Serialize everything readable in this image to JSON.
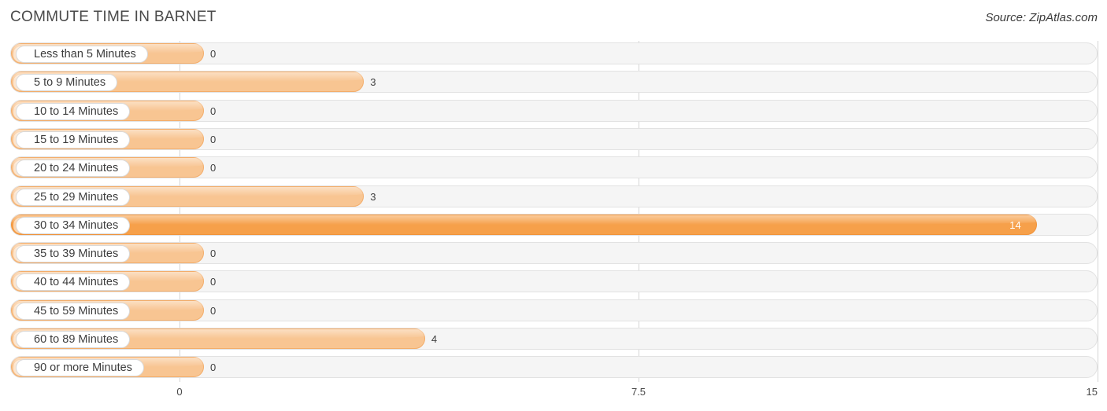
{
  "header": {
    "title": "COMMUTE TIME IN BARNET",
    "source": "Source: ZipAtlas.com"
  },
  "chart_data": {
    "type": "bar",
    "orientation": "horizontal",
    "title": "COMMUTE TIME IN BARNET",
    "xlabel": "",
    "ylabel": "",
    "xlim": [
      0,
      15
    ],
    "ticks": [
      "0",
      "7.5",
      "15"
    ],
    "tick_values": [
      0,
      7.5,
      15
    ],
    "grid": true,
    "categories": [
      "Less than 5 Minutes",
      "5 to 9 Minutes",
      "10 to 14 Minutes",
      "15 to 19 Minutes",
      "20 to 24 Minutes",
      "25 to 29 Minutes",
      "30 to 34 Minutes",
      "35 to 39 Minutes",
      "40 to 44 Minutes",
      "45 to 59 Minutes",
      "60 to 89 Minutes",
      "90 or more Minutes"
    ],
    "values": [
      0,
      3,
      0,
      0,
      0,
      3,
      14,
      0,
      0,
      0,
      4,
      0
    ],
    "value_labels": [
      "0",
      "3",
      "0",
      "0",
      "0",
      "3",
      "14",
      "0",
      "0",
      "0",
      "4",
      "0"
    ],
    "colors": {
      "bar": "#f8c592",
      "bar_highlight": "#f6a04a",
      "track": "#f5f5f5",
      "grid": "#d5d5d5"
    }
  }
}
